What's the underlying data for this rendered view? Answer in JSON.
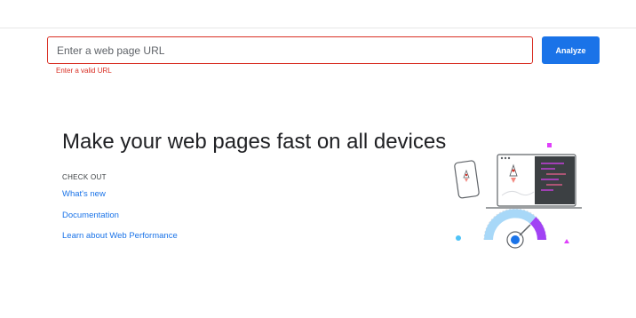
{
  "search": {
    "placeholder": "Enter a web page URL",
    "value": "",
    "error": "Enter a valid URL",
    "analyze_label": "Analyze"
  },
  "main": {
    "headline": "Make your web pages fast on all devices",
    "checkout_label": "CHECK OUT",
    "links": [
      {
        "label": "What's new"
      },
      {
        "label": "Documentation"
      },
      {
        "label": "Learn about Web Performance"
      }
    ]
  },
  "colors": {
    "accent": "#1a73e8",
    "error": "#d93025",
    "illustration_pink": "#e040fb",
    "illustration_purple": "#a142f4",
    "illustration_light_blue": "#a8d8f8"
  },
  "illustration": {
    "icon": "devices-speed-gauge-illustration"
  }
}
